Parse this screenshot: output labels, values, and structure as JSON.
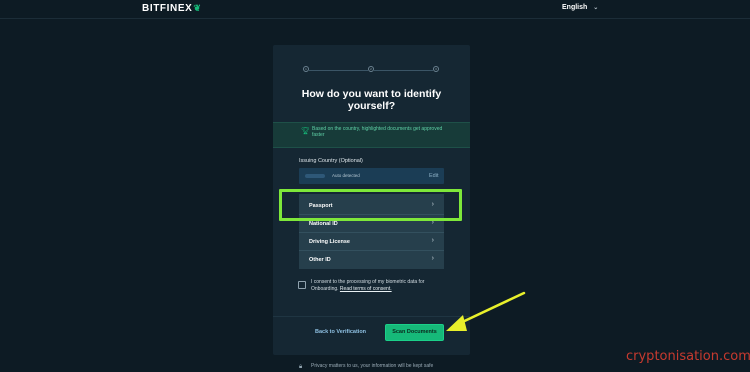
{
  "header": {
    "logo_text": "BITFINEX",
    "logo_icon": "leaf-icon",
    "language": "English"
  },
  "stepper": {
    "steps": [
      "1",
      "2",
      "3"
    ],
    "current": 1
  },
  "title": "How do you want to identify yourself?",
  "info_banner": {
    "icon": "trophy-icon",
    "text": "Based on the country, highlighted documents get approved faster"
  },
  "country": {
    "label": "Issuing Country (Optional)",
    "auto_text": "Auto detected",
    "edit_label": "Edit"
  },
  "documents": [
    {
      "label": "Passport"
    },
    {
      "label": "National ID"
    },
    {
      "label": "Driving License"
    },
    {
      "label": "Other ID"
    }
  ],
  "consent": {
    "text": "I consent to the processing of my biometric data for Onboarding.",
    "link": "Read terms of consent."
  },
  "actions": {
    "back_label": "Back to Verification",
    "scan_label": "Scan Documents"
  },
  "privacy": {
    "icon": "lock-icon",
    "text": "Privacy matters to us, your information will be kept safe"
  },
  "watermark": "cryptonisation.com",
  "colors": {
    "background": "#0d1b24",
    "card": "#152733",
    "accent": "#16b979",
    "highlight": "#7ee83a",
    "arrow": "#e8f02b",
    "watermark": "#c73a2f"
  }
}
